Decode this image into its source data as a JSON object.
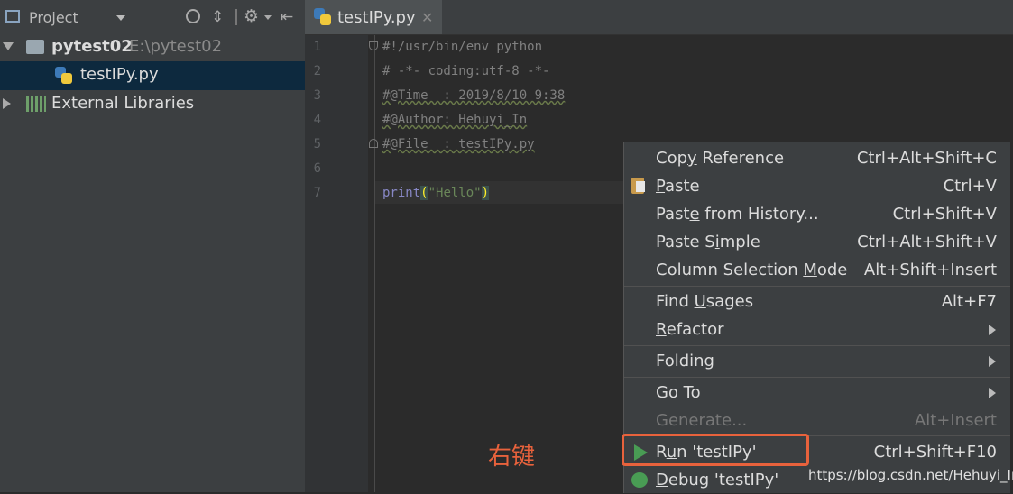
{
  "project_panel": {
    "title": "Project",
    "root": {
      "name": "pytest02",
      "path": "E:\\pytest02"
    },
    "file": "testIPy.py",
    "external": "External Libraries"
  },
  "editor": {
    "tab_label": "testIPy.py",
    "line_numbers": [
      "1",
      "2",
      "3",
      "4",
      "5",
      "6",
      "7"
    ],
    "lines": {
      "l1": "#!/usr/bin/env python",
      "l2": "# -*- coding:utf-8 -*-",
      "l3": "#@Time  : 2019/8/10 9:38",
      "l4": "#@Author: Hehuyi_In",
      "l5": "#@File  : testIPy.py",
      "l7_func": "print",
      "l7_open": "(",
      "l7_str": "\"Hello\"",
      "l7_close": ")"
    }
  },
  "context_menu": {
    "copy_reference": {
      "pre": "Cop",
      "mn": "y",
      "post": " Reference",
      "key": "Ctrl+Alt+Shift+C"
    },
    "paste": {
      "mn": "P",
      "post": "aste",
      "key": "Ctrl+V"
    },
    "paste_history": {
      "pre": "Past",
      "mn": "e",
      "post": " from History...",
      "key": "Ctrl+Shift+V"
    },
    "paste_simple": {
      "pre": "Paste S",
      "mn": "i",
      "post": "mple",
      "key": "Ctrl+Alt+Shift+V"
    },
    "column_selection": {
      "pre": "Column Selection ",
      "mn": "M",
      "post": "ode",
      "key": "Alt+Shift+Insert"
    },
    "find_usages": {
      "pre": "Find ",
      "mn": "U",
      "post": "sages",
      "key": "Alt+F7"
    },
    "refactor": {
      "mn": "R",
      "post": "efactor"
    },
    "folding": {
      "label": "Folding"
    },
    "goto": {
      "label": "Go To"
    },
    "generate": {
      "label": "Generate...",
      "key": "Alt+Insert"
    },
    "run": {
      "pre": "R",
      "mn": "u",
      "post": "n 'testIPy'",
      "key": "Ctrl+Shift+F10"
    },
    "debug": {
      "mn": "D",
      "post": "ebug 'testIPy'"
    }
  },
  "annotation": {
    "text": "右键",
    "color": "#e8623c"
  },
  "watermark": "https://blog.csdn.net/Hehuyi_In"
}
